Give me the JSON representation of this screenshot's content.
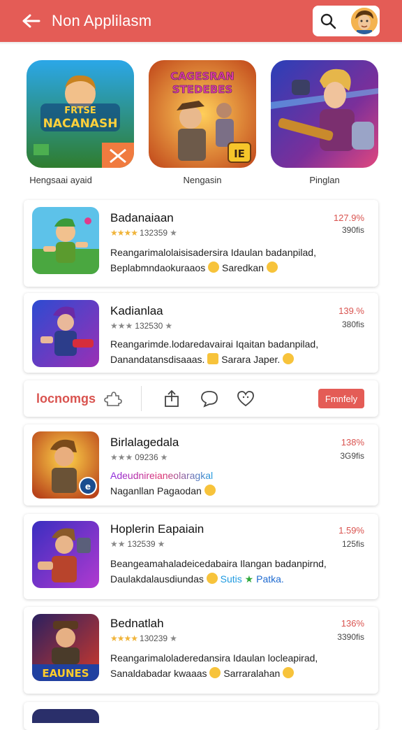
{
  "header": {
    "title": "Non Applilasm",
    "icons": [
      "back-arrow-icon",
      "search-icon",
      "avatar"
    ]
  },
  "featured": [
    {
      "label": "Hengsaai ayaid",
      "art_text": "FRTSE NACANASH"
    },
    {
      "label": "Nengasin",
      "art_text": "CAGESRAN STEDEBES",
      "badge": "IE"
    },
    {
      "label": "Pinglan"
    }
  ],
  "cards": [
    {
      "title": "Badanaiaan",
      "rating_text": "132359",
      "price": "127.9%",
      "sub": "390fis",
      "desc1": "Reangarimalolaisisadersira Idaulan badanpilad,",
      "desc2": "Beplabmndaokuraaos",
      "desc2_tail": "Saredkan"
    },
    {
      "title": "Kadianlaa",
      "rating_text": "132530",
      "price": "139.%",
      "sub": "380fis",
      "desc1": "Reangarimde.lodaredavairai Iqaitan badanpilad,",
      "desc2": "Danandatansdisaaas.",
      "desc2_tail": "Sarara Japer."
    },
    {
      "title": "Birlalagedala",
      "rating_text": "09236",
      "price": "138%",
      "sub": "3G9fis",
      "desc1": "Adeudnireianeolaragkal",
      "desc2": "Naganllan Pagaodan",
      "desc2_tail": ""
    },
    {
      "title": "Hoplerin Eapaiain",
      "rating_text": "132539",
      "price": "1.59%",
      "sub": "125fis",
      "desc1": "Beangeamahaladeicedabaira Ilangan badanpirnd,",
      "desc2": "Daulakdalausdiundas",
      "desc2_tail": "Sutis",
      "desc2_tail2": "Patka."
    },
    {
      "title": "Bednatlah",
      "rating_text": "130239",
      "price": "136%",
      "sub": "3390fis",
      "desc1": "Reangarimaloladeredansira Idaulan locleapirad,",
      "desc2": "Sanaldabadar kwaaas",
      "desc2_tail": "Sarraralahan"
    }
  ],
  "actionbar": {
    "label": "locnomgs",
    "follow": "Fmnfely",
    "icons": [
      "puzzle-icon",
      "share-icon",
      "comment-icon",
      "heart-icon"
    ]
  },
  "colors": {
    "accent": "#e45c56",
    "price": "#d9534f",
    "star": "#f0b43a"
  }
}
